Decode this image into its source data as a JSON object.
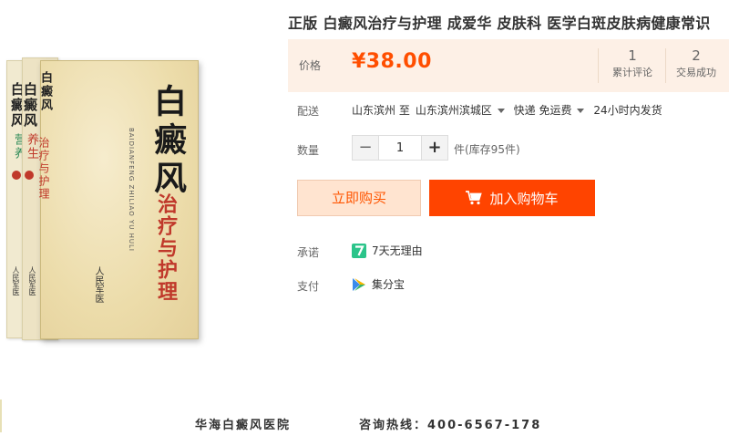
{
  "product": {
    "title": "正版 白癜风治疗与护理 成爱华 皮肤科 医学白斑皮肤病健康常识"
  },
  "price_panel": {
    "label": "价格",
    "price": "¥38.00",
    "reviews_count": "1",
    "reviews_label": "累计评论",
    "sales_count": "2",
    "sales_label": "交易成功"
  },
  "delivery": {
    "label": "配送",
    "from": "山东滨州 至",
    "to": "山东滨州滨城区",
    "shipping": "快递 免运费",
    "dispatch": "24小时内发货"
  },
  "quantity": {
    "label": "数量",
    "minus": "−",
    "value": "1",
    "plus": "+",
    "stock": "件(库存95件)"
  },
  "actions": {
    "buy_now": "立即购买",
    "add_to_cart": "加入购物车"
  },
  "promise": {
    "label": "承诺",
    "text": "7天无理由"
  },
  "payment": {
    "label": "支付",
    "text": "集分宝"
  },
  "book_cover": {
    "front_title": "白癜风",
    "front_subtitle": "治疗与护理",
    "front_pinyin": "BAIDIANFENG ZHILIAO YU HULI",
    "spine1_title": "白癜风",
    "spine1_subtitle": "养生",
    "spine2_title": "白癜风",
    "spine2_subtitle": "营养",
    "publisher": "人民军医"
  },
  "footer": {
    "hospital": "华海白癜风医院",
    "hotline": "咨询热线：400-6567-178"
  },
  "colors": {
    "accent": "#ff4400",
    "price": "#ff4e00",
    "price_panel_bg": "#fdf0e6",
    "promise_icon": "#2bc48a",
    "buy_now_bg": "#ffe4d0"
  }
}
